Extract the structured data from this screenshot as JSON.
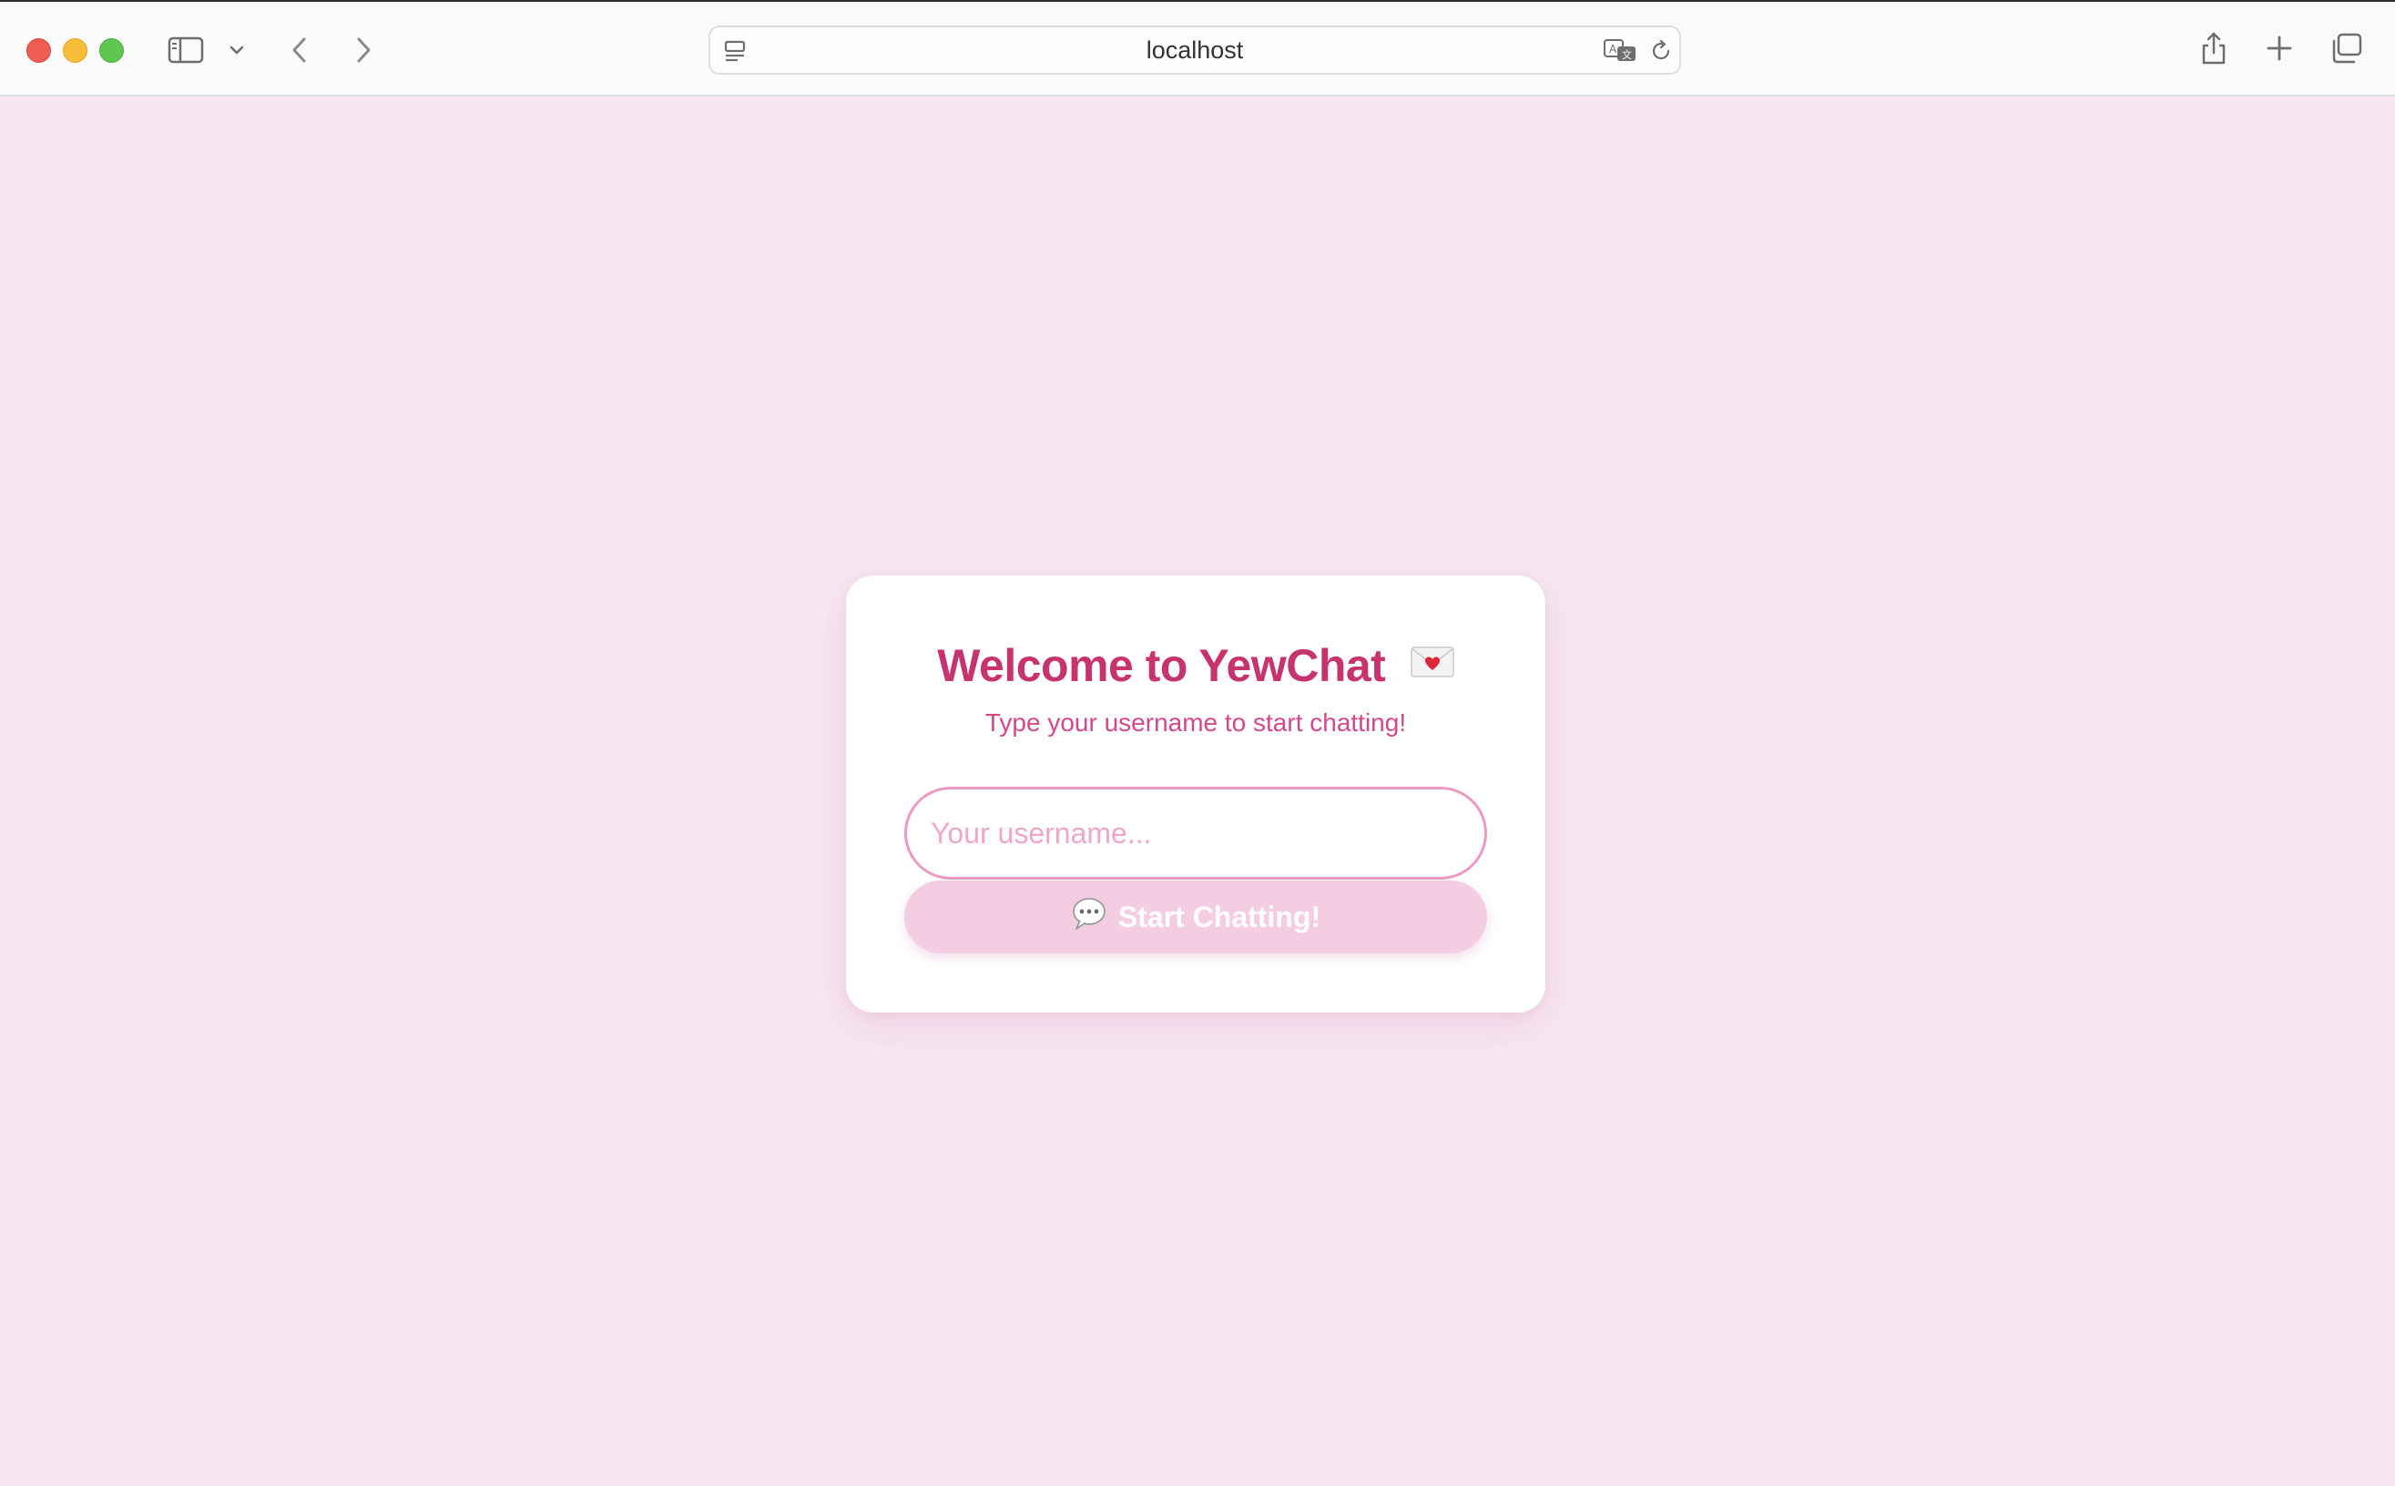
{
  "browser": {
    "address": "localhost",
    "icons": {
      "sidebar": "sidebar-icon",
      "sidebar_menu": "chevron-down-icon",
      "back": "back-arrow-icon",
      "forward": "forward-arrow-icon",
      "page_menu": "page-menu-icon",
      "translate": "translate-icon",
      "reload": "reload-icon",
      "share": "share-icon",
      "new_tab": "plus-icon",
      "tab_overview": "tab-overview-icon"
    }
  },
  "login": {
    "title": "Welcome to YewChat",
    "title_icon": "love-letter-icon",
    "subtitle": "Type your username to start chatting!",
    "username_placeholder": "Your username...",
    "username_value": "",
    "button_label": "Start Chatting!",
    "button_icon": "speech-bubble-icon"
  },
  "colors": {
    "page_background": "#f7e6f1",
    "card_background": "#ffffff",
    "title": "#c7336e",
    "subtitle": "#d6478a",
    "input_border": "#ec9ac4",
    "button_background": "#f5cde3"
  }
}
